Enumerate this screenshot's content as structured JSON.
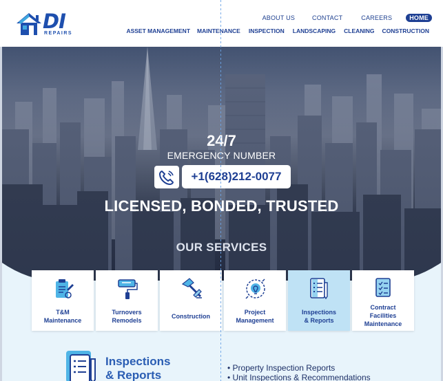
{
  "brand": {
    "logo_text": "DI",
    "logo_subtext": "REPAIRS",
    "colors": {
      "primary": "#1e3f93",
      "accent": "#2a5db3",
      "light_bg": "#e8f4fb",
      "active_card": "#bfe2f5"
    }
  },
  "nav_top": {
    "items": [
      "ABOUT US",
      "CONTACT",
      "CAREERS"
    ],
    "active": "HOME"
  },
  "nav_main": {
    "items": [
      "ASSET MANAGEMENT",
      "MAINTENANCE",
      "INSPECTION",
      "LANDSCAPING",
      "CLEANING",
      "CONSTRUCTION"
    ]
  },
  "hero": {
    "title": "24/7",
    "subtitle": "EMERGENCY NUMBER",
    "phone": "+1(628)212-0077",
    "phone_icon": "phone-icon",
    "tagline": "LICENSED, BONDED, TRUSTED",
    "services_heading": "OUR SERVICES"
  },
  "services": [
    {
      "label_1": "T&M",
      "label_2": "Maintenance",
      "icon": "clipboard-tools-icon",
      "active": false
    },
    {
      "label_1": "Turnovers",
      "label_2": "Remodels",
      "icon": "paint-roller-icon",
      "active": false
    },
    {
      "label_1": "Construction",
      "label_2": "",
      "icon": "hammer-icon",
      "active": false
    },
    {
      "label_1": "Project",
      "label_2": "Management",
      "icon": "lightbulb-gear-icon",
      "active": false
    },
    {
      "label_1": "Inspections",
      "label_2": "& Reports",
      "icon": "checklist-pen-icon",
      "active": true
    },
    {
      "label_1": "Contract",
      "label_2": "Facilities",
      "label_3": "Maintenance",
      "icon": "document-checklist-icon",
      "active": false
    }
  ],
  "detail": {
    "title_1": "Inspections",
    "title_2": "& Reports",
    "icon": "checklist-pen-icon",
    "bullets": [
      "Property Inspection Reports",
      "Unit Inspections & Recommendations"
    ]
  }
}
